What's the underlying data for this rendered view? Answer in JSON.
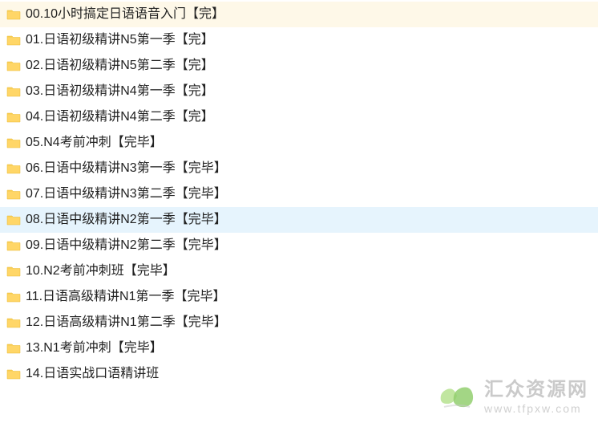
{
  "files": [
    {
      "name": "00.10小时搞定日语语音入门【完】",
      "highlighted": "first"
    },
    {
      "name": "01.日语初级精讲N5第一季【完】",
      "highlighted": false
    },
    {
      "name": "02.日语初级精讲N5第二季【完】",
      "highlighted": false
    },
    {
      "name": "03.日语初级精讲N4第一季【完】",
      "highlighted": false
    },
    {
      "name": "04.日语初级精讲N4第二季【完】",
      "highlighted": false
    },
    {
      "name": "05.N4考前冲刺【完毕】",
      "highlighted": false
    },
    {
      "name": "06.日语中级精讲N3第一季【完毕】",
      "highlighted": false
    },
    {
      "name": "07.日语中级精讲N3第二季【完毕】",
      "highlighted": false
    },
    {
      "name": "08.日语中级精讲N2第一季【完毕】",
      "highlighted": "selected"
    },
    {
      "name": "09.日语中级精讲N2第二季【完毕】",
      "highlighted": false
    },
    {
      "name": "10.N2考前冲刺班【完毕】",
      "highlighted": false
    },
    {
      "name": "11.日语高级精讲N1第一季【完毕】",
      "highlighted": false
    },
    {
      "name": "12.日语高级精讲N1第二季【完毕】",
      "highlighted": false
    },
    {
      "name": "13.N1考前冲刺【完毕】",
      "highlighted": false
    },
    {
      "name": "14.日语实战口语精讲班",
      "highlighted": false
    }
  ],
  "watermark": {
    "title": "汇众资源网",
    "url": "www.tfpxw.com"
  }
}
